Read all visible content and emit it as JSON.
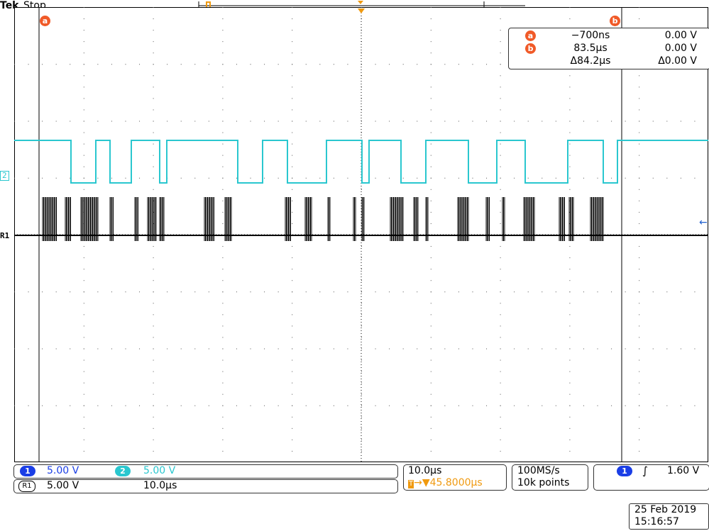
{
  "header": {
    "brand": "Tek",
    "acquisition_state": "Stop"
  },
  "cursors": {
    "a": {
      "label": "a",
      "time": "−700ns",
      "voltage": "0.00 V"
    },
    "b": {
      "label": "b",
      "time": "83.5µs",
      "voltage": "0.00 V"
    },
    "delta": {
      "time": "Δ84.2µs",
      "voltage": "Δ0.00 V"
    }
  },
  "channel_markers": {
    "ch2": "2",
    "ref1": "R1"
  },
  "channels": {
    "ch1": {
      "label": "1",
      "scale": "5.00 V",
      "color": "#1a3ee6"
    },
    "ch2": {
      "label": "2",
      "scale": "5.00 V",
      "color": "#2ac7cf"
    },
    "ref1": {
      "label": "R1",
      "scale": "5.00 V",
      "timebase": "10.0µs"
    }
  },
  "horizontal": {
    "timebase": "10.0µs",
    "position": "▼45.8000µs",
    "pos_icon": "trigger-position-icon"
  },
  "acquisition": {
    "sample_rate": "100MS/s",
    "record_length": "10k points"
  },
  "trigger": {
    "source": "1",
    "slope_icon": "rising-edge-icon",
    "slope_glyph": "∫",
    "level": "1.60 V"
  },
  "datetime": {
    "date": "25 Feb  2019",
    "time": "15:16:57"
  },
  "colors": {
    "cursor": "#f05a28",
    "ch2": "#2ac7cf",
    "ch1": "#1a3ee6",
    "horizontal": "#f09a10"
  }
}
